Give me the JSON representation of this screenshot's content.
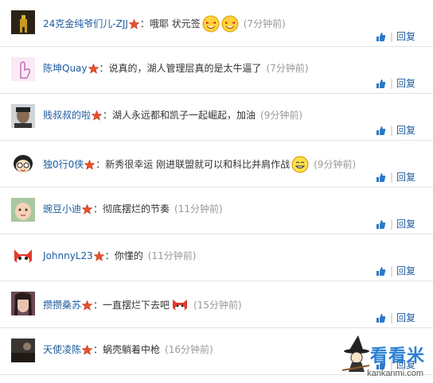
{
  "colors": {
    "username": "#1c5b9e",
    "time": "#999999",
    "divider": "#e3e3e3",
    "logo": "#2a7fd4"
  },
  "like_icon": "thumbs-up-icon",
  "reply_label": "回复",
  "separator": "|",
  "comments": [
    {
      "user": "24克金纯爷们儿-ZJJ",
      "colon": "：",
      "text": "哦耶  状元签",
      "time": "(7分钟前)",
      "avatar": "gold-figure"
    },
    {
      "user": "陈坤Quay",
      "colon": "：",
      "text": "说真的，湖人管理层真的是太牛逼了",
      "time": "(7分钟前)",
      "avatar": "pink-hand"
    },
    {
      "user": "贱叔叔的啦",
      "colon": "：",
      "text": "湖人永远都和凯子一起崛起，加油",
      "time": "(9分钟前)",
      "avatar": "man-face"
    },
    {
      "user": "独0行0侠",
      "colon": "：",
      "text": "新秀很幸运 刚进联盟就可以和科比并肩作战",
      "time": "(9分钟前)",
      "avatar": "cartoon-boy"
    },
    {
      "user": "豌豆小迪",
      "colon": "：",
      "text": "彻底摆烂的节奏",
      "time": "(11分钟前)",
      "avatar": "baby-face"
    },
    {
      "user": "JohnnyL23",
      "colon": "：",
      "text": "你懂的",
      "time": "(11分钟前)",
      "avatar": "red-fox"
    },
    {
      "user": "攒攒桑苏",
      "colon": "：",
      "text": "一直摆烂下去吧",
      "time": "(15分钟前)",
      "avatar": "girl-photo"
    },
    {
      "user": "天使凌陈",
      "colon": "：",
      "text": "蜗壳躺着中枪",
      "time": "(16分钟前)",
      "avatar": "dark-scene"
    }
  ],
  "logo": {
    "name": "看看米",
    "domain": "kankanmi.com"
  }
}
